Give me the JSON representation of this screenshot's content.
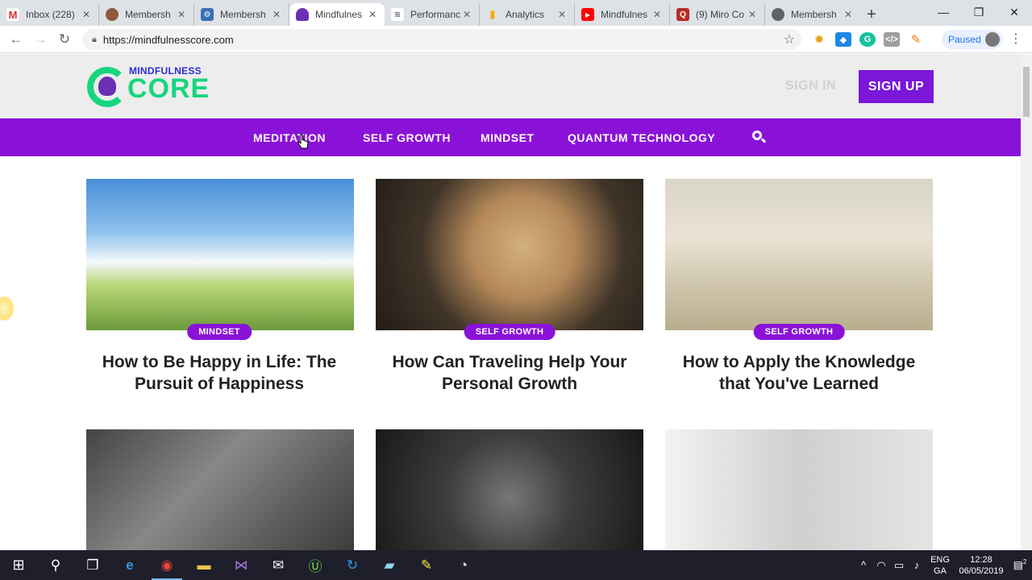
{
  "browser": {
    "tabs": [
      {
        "title": "Inbox (228)",
        "favicon": "gmail-icon",
        "color": "#d93025",
        "glyph": "M"
      },
      {
        "title": "Membersh",
        "favicon": "avatar-icon",
        "color": "#8d5a3b",
        "glyph": ""
      },
      {
        "title": "Membersh",
        "favicon": "gear-icon",
        "color": "#3b6fb6",
        "glyph": ""
      },
      {
        "title": "Mindfulnes",
        "favicon": "meditation-icon",
        "color": "#6b2fb3",
        "glyph": ""
      },
      {
        "title": "Performanc",
        "favicon": "performance-icon",
        "color": "#5f6368",
        "glyph": ""
      },
      {
        "title": "Analytics",
        "favicon": "analytics-icon",
        "color": "#f9ab00",
        "glyph": ""
      },
      {
        "title": "Mindfulnes",
        "favicon": "youtube-icon",
        "color": "#ff0000",
        "glyph": "▶"
      },
      {
        "title": "(9) Miro Co",
        "favicon": "quora-icon",
        "color": "#b92b27",
        "glyph": "Q"
      },
      {
        "title": "Membersh",
        "favicon": "globe-icon",
        "color": "#5f6368",
        "glyph": ""
      }
    ],
    "active_tab": 3,
    "url": "https://mindfulnesscore.com",
    "profile_status": "Paused"
  },
  "site": {
    "logo_top": "MINDFULNESS",
    "logo_main": "CORE",
    "sign_in": "SIGN IN",
    "sign_up": "SIGN UP",
    "nav": [
      {
        "label": "MEDITATION"
      },
      {
        "label": "SELF GROWTH"
      },
      {
        "label": "MINDSET"
      },
      {
        "label": "QUANTUM TECHNOLOGY"
      }
    ],
    "posts": [
      {
        "category": "MINDSET",
        "title": "How to Be Happy in Life: The Pursuit of Happiness"
      },
      {
        "category": "SELF GROWTH",
        "title": "How Can Traveling Help Your Personal Growth"
      },
      {
        "category": "SELF GROWTH",
        "title": "How to Apply the Knowledge that You've Learned"
      },
      {
        "category": "",
        "title": ""
      },
      {
        "category": "",
        "title": ""
      },
      {
        "category": "",
        "title": ""
      }
    ],
    "accent_color": "#8a12d8"
  },
  "taskbar": {
    "lang_top": "ENG",
    "lang_bottom": "GA",
    "time": "12:28",
    "date": "06/05/2019",
    "notifications": "2"
  }
}
